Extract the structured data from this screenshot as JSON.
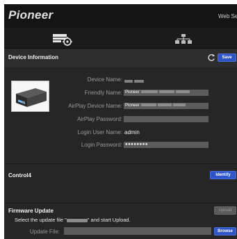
{
  "header": {
    "logo": "Pioneer",
    "link": "Web Setu"
  },
  "tabs": [
    {
      "name": "device",
      "icon": "device-settings-icon"
    },
    {
      "name": "network",
      "icon": "network-icon"
    }
  ],
  "device_info": {
    "title": "Device Information",
    "save_label": "Save",
    "refresh_icon": "refresh-icon",
    "fields": {
      "device_name_label": "Device Name:",
      "friendly_name_label": "Friendly Name:",
      "friendly_name_value": "Pioneer",
      "airplay_name_label": "AirPlay Device Name:",
      "airplay_name_value": "Pioneer",
      "airplay_password_label": "AirPlay Password:",
      "login_user_label": "Login User Name:",
      "login_user_value": "admin",
      "login_password_label": "Login Password:",
      "login_password_value": "●●●●●●●●"
    }
  },
  "control4": {
    "title": "Control4",
    "identify_label": "Identify"
  },
  "firmware": {
    "title": "Firmware Update",
    "instruction_prefix": "Select the update file \"",
    "instruction_suffix": "\" and start Upload.",
    "upload_label": "Upload",
    "update_file_label": "Update File:",
    "browse_label": "Browse"
  },
  "colors": {
    "accent_button": "#2f55c9",
    "background": "#262626",
    "header": "#141414"
  }
}
